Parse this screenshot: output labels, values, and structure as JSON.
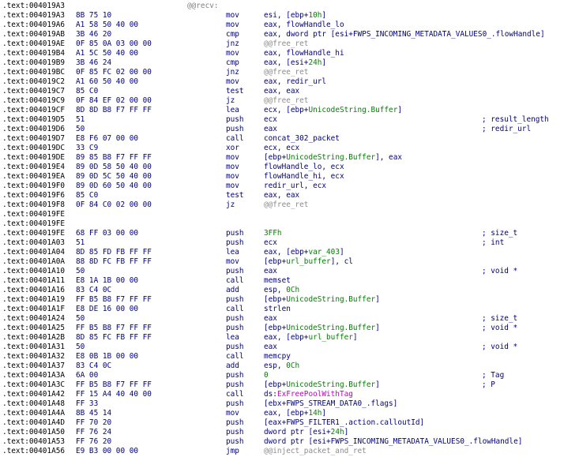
{
  "lines": [
    {
      "addr": ".text:004019A3",
      "bytes": "",
      "mn": "",
      "op": [],
      "label": "@@recv:",
      "cm": ""
    },
    {
      "addr": ".text:004019A3",
      "bytes": "8B 75 10",
      "mn": "mov",
      "op": [
        {
          "t": "esi, [ebp+"
        },
        {
          "t": "10h",
          "c": "g"
        },
        {
          "t": "]"
        }
      ],
      "label": "",
      "cm": ""
    },
    {
      "addr": ".text:004019A6",
      "bytes": "A1 58 50 40 00",
      "mn": "mov",
      "op": [
        {
          "t": "eax, flowHandle_lo"
        }
      ],
      "label": "",
      "cm": ""
    },
    {
      "addr": ".text:004019AB",
      "bytes": "3B 46 20",
      "mn": "cmp",
      "op": [
        {
          "t": "eax, dword ptr [esi+FWPS_INCOMING_METADATA_VALUES0_.flowHandle]"
        }
      ],
      "label": "",
      "cm": ""
    },
    {
      "addr": ".text:004019AE",
      "bytes": "0F 85 0A 03 00 00",
      "mn": "jnz",
      "op": [
        {
          "t": "@@free_ret",
          "c": "dim"
        }
      ],
      "label": "",
      "cm": ""
    },
    {
      "addr": ".text:004019B4",
      "bytes": "A1 5C 50 40 00",
      "mn": "mov",
      "op": [
        {
          "t": "eax, flowHandle_hi"
        }
      ],
      "label": "",
      "cm": ""
    },
    {
      "addr": ".text:004019B9",
      "bytes": "3B 46 24",
      "mn": "cmp",
      "op": [
        {
          "t": "eax, [esi+"
        },
        {
          "t": "24h",
          "c": "g"
        },
        {
          "t": "]"
        }
      ],
      "label": "",
      "cm": ""
    },
    {
      "addr": ".text:004019BC",
      "bytes": "0F 85 FC 02 00 00",
      "mn": "jnz",
      "op": [
        {
          "t": "@@free_ret",
          "c": "dim"
        }
      ],
      "label": "",
      "cm": ""
    },
    {
      "addr": ".text:004019C2",
      "bytes": "A1 60 50 40 00",
      "mn": "mov",
      "op": [
        {
          "t": "eax, redir_url"
        }
      ],
      "label": "",
      "cm": ""
    },
    {
      "addr": ".text:004019C7",
      "bytes": "85 C0",
      "mn": "test",
      "op": [
        {
          "t": "eax, eax"
        }
      ],
      "label": "",
      "cm": ""
    },
    {
      "addr": ".text:004019C9",
      "bytes": "0F 84 EF 02 00 00",
      "mn": "jz",
      "op": [
        {
          "t": "@@free_ret",
          "c": "dim"
        }
      ],
      "label": "",
      "cm": ""
    },
    {
      "addr": ".text:004019CF",
      "bytes": "8D 8D B8 F7 FF FF",
      "mn": "lea",
      "op": [
        {
          "t": "ecx, [ebp+"
        },
        {
          "t": "UnicodeString.Buffer",
          "c": "g"
        },
        {
          "t": "]"
        }
      ],
      "label": "",
      "cm": ""
    },
    {
      "addr": ".text:004019D5",
      "bytes": "51",
      "mn": "push",
      "op": [
        {
          "t": "ecx"
        }
      ],
      "label": "",
      "cm": "; result_length"
    },
    {
      "addr": ".text:004019D6",
      "bytes": "50",
      "mn": "push",
      "op": [
        {
          "t": "eax"
        }
      ],
      "label": "",
      "cm": "; redir_url"
    },
    {
      "addr": ".text:004019D7",
      "bytes": "E8 F6 07 00 00",
      "mn": "call",
      "op": [
        {
          "t": "concat_302_packet"
        }
      ],
      "label": "",
      "cm": ""
    },
    {
      "addr": ".text:004019DC",
      "bytes": "33 C9",
      "mn": "xor",
      "op": [
        {
          "t": "ecx, ecx"
        }
      ],
      "label": "",
      "cm": ""
    },
    {
      "addr": ".text:004019DE",
      "bytes": "89 85 B8 F7 FF FF",
      "mn": "mov",
      "op": [
        {
          "t": "[ebp+"
        },
        {
          "t": "UnicodeString.Buffer",
          "c": "g"
        },
        {
          "t": "], eax"
        }
      ],
      "label": "",
      "cm": ""
    },
    {
      "addr": ".text:004019E4",
      "bytes": "89 0D 58 50 40 00",
      "mn": "mov",
      "op": [
        {
          "t": "flowHandle_lo, ecx"
        }
      ],
      "label": "",
      "cm": ""
    },
    {
      "addr": ".text:004019EA",
      "bytes": "89 0D 5C 50 40 00",
      "mn": "mov",
      "op": [
        {
          "t": "flowHandle_hi, ecx"
        }
      ],
      "label": "",
      "cm": ""
    },
    {
      "addr": ".text:004019F0",
      "bytes": "89 0D 60 50 40 00",
      "mn": "mov",
      "op": [
        {
          "t": "redir_url, ecx"
        }
      ],
      "label": "",
      "cm": ""
    },
    {
      "addr": ".text:004019F6",
      "bytes": "85 C0",
      "mn": "test",
      "op": [
        {
          "t": "eax, eax"
        }
      ],
      "label": "",
      "cm": ""
    },
    {
      "addr": ".text:004019F8",
      "bytes": "0F 84 C0 02 00 00",
      "mn": "jz",
      "op": [
        {
          "t": "@@free_ret",
          "c": "dim"
        }
      ],
      "label": "",
      "cm": ""
    },
    {
      "addr": ".text:004019FE",
      "bytes": "",
      "mn": "",
      "op": [],
      "label": "",
      "cm": ""
    },
    {
      "addr": ".text:004019FE",
      "bytes": "",
      "mn": "",
      "op": [],
      "label": "",
      "cm": ""
    },
    {
      "addr": ".text:004019FE",
      "bytes": "68 FF 03 00 00",
      "mn": "push",
      "op": [
        {
          "t": "3FFh",
          "c": "g"
        }
      ],
      "label": "",
      "cm": "; size_t"
    },
    {
      "addr": ".text:00401A03",
      "bytes": "51",
      "mn": "push",
      "op": [
        {
          "t": "ecx"
        }
      ],
      "label": "",
      "cm": "; int"
    },
    {
      "addr": ".text:00401A04",
      "bytes": "8D 85 FD FB FF FF",
      "mn": "lea",
      "op": [
        {
          "t": "eax, [ebp+"
        },
        {
          "t": "var_403",
          "c": "g"
        },
        {
          "t": "]"
        }
      ],
      "label": "",
      "cm": ""
    },
    {
      "addr": ".text:00401A0A",
      "bytes": "88 8D FC FB FF FF",
      "mn": "mov",
      "op": [
        {
          "t": "[ebp+"
        },
        {
          "t": "url_buffer",
          "c": "g"
        },
        {
          "t": "], cl"
        }
      ],
      "label": "",
      "cm": ""
    },
    {
      "addr": ".text:00401A10",
      "bytes": "50",
      "mn": "push",
      "op": [
        {
          "t": "eax"
        }
      ],
      "label": "",
      "cm": "; void *"
    },
    {
      "addr": ".text:00401A11",
      "bytes": "E8 1A 1B 00 00",
      "mn": "call",
      "op": [
        {
          "t": "memset"
        }
      ],
      "label": "",
      "cm": ""
    },
    {
      "addr": ".text:00401A16",
      "bytes": "83 C4 0C",
      "mn": "add",
      "op": [
        {
          "t": "esp, "
        },
        {
          "t": "0Ch",
          "c": "g"
        }
      ],
      "label": "",
      "cm": ""
    },
    {
      "addr": ".text:00401A19",
      "bytes": "FF B5 B8 F7 FF FF",
      "mn": "push",
      "op": [
        {
          "t": "[ebp+"
        },
        {
          "t": "UnicodeString.Buffer",
          "c": "g"
        },
        {
          "t": "]"
        }
      ],
      "label": "",
      "cm": ""
    },
    {
      "addr": ".text:00401A1F",
      "bytes": "E8 DE 16 00 00",
      "mn": "call",
      "op": [
        {
          "t": "strlen"
        }
      ],
      "label": "",
      "cm": ""
    },
    {
      "addr": ".text:00401A24",
      "bytes": "50",
      "mn": "push",
      "op": [
        {
          "t": "eax"
        }
      ],
      "label": "",
      "cm": "; size_t"
    },
    {
      "addr": ".text:00401A25",
      "bytes": "FF B5 B8 F7 FF FF",
      "mn": "push",
      "op": [
        {
          "t": "[ebp+"
        },
        {
          "t": "UnicodeString.Buffer",
          "c": "g"
        },
        {
          "t": "]"
        }
      ],
      "label": "",
      "cm": "; void *"
    },
    {
      "addr": ".text:00401A2B",
      "bytes": "8D 85 FC FB FF FF",
      "mn": "lea",
      "op": [
        {
          "t": "eax, [ebp+"
        },
        {
          "t": "url_buffer",
          "c": "g"
        },
        {
          "t": "]"
        }
      ],
      "label": "",
      "cm": ""
    },
    {
      "addr": ".text:00401A31",
      "bytes": "50",
      "mn": "push",
      "op": [
        {
          "t": "eax"
        }
      ],
      "label": "",
      "cm": "; void *"
    },
    {
      "addr": ".text:00401A32",
      "bytes": "E8 0B 1B 00 00",
      "mn": "call",
      "op": [
        {
          "t": "memcpy"
        }
      ],
      "label": "",
      "cm": ""
    },
    {
      "addr": ".text:00401A37",
      "bytes": "83 C4 0C",
      "mn": "add",
      "op": [
        {
          "t": "esp, "
        },
        {
          "t": "0Ch",
          "c": "g"
        }
      ],
      "label": "",
      "cm": ""
    },
    {
      "addr": ".text:00401A3A",
      "bytes": "6A 00",
      "mn": "push",
      "op": [
        {
          "t": "0",
          "c": "g"
        }
      ],
      "label": "",
      "cm": "; Tag"
    },
    {
      "addr": ".text:00401A3C",
      "bytes": "FF B5 B8 F7 FF FF",
      "mn": "push",
      "op": [
        {
          "t": "[ebp+"
        },
        {
          "t": "UnicodeString.Buffer",
          "c": "g"
        },
        {
          "t": "]"
        }
      ],
      "label": "",
      "cm": "; P"
    },
    {
      "addr": ".text:00401A42",
      "bytes": "FF 15 A4 40 40 00",
      "mn": "call",
      "op": [
        {
          "t": "ds:"
        },
        {
          "t": "ExFreePoolWithTag",
          "c": "m"
        }
      ],
      "label": "",
      "cm": ""
    },
    {
      "addr": ".text:00401A48",
      "bytes": "FF 33",
      "mn": "push",
      "op": [
        {
          "t": "[ebx+FWPS_STREAM_DATA0_.flags]"
        }
      ],
      "label": "",
      "cm": ""
    },
    {
      "addr": ".text:00401A4A",
      "bytes": "8B 45 14",
      "mn": "mov",
      "op": [
        {
          "t": "eax, [ebp+"
        },
        {
          "t": "14h",
          "c": "g"
        },
        {
          "t": "]"
        }
      ],
      "label": "",
      "cm": ""
    },
    {
      "addr": ".text:00401A4D",
      "bytes": "FF 70 20",
      "mn": "push",
      "op": [
        {
          "t": "[eax+FWPS_FILTER1_.action.calloutId]"
        }
      ],
      "label": "",
      "cm": ""
    },
    {
      "addr": ".text:00401A50",
      "bytes": "FF 76 24",
      "mn": "push",
      "op": [
        {
          "t": "dword ptr [esi+"
        },
        {
          "t": "24h",
          "c": "g"
        },
        {
          "t": "]"
        }
      ],
      "label": "",
      "cm": ""
    },
    {
      "addr": ".text:00401A53",
      "bytes": "FF 76 20",
      "mn": "push",
      "op": [
        {
          "t": "dword ptr [esi+FWPS_INCOMING_METADATA_VALUES0_.flowHandle]"
        }
      ],
      "label": "",
      "cm": ""
    },
    {
      "addr": ".text:00401A56",
      "bytes": "E9 B3 00 00 00",
      "mn": "jmp",
      "op": [
        {
          "t": "@@inject_packet_and_ret",
          "c": "dim"
        }
      ],
      "label": "",
      "cm": ""
    }
  ]
}
